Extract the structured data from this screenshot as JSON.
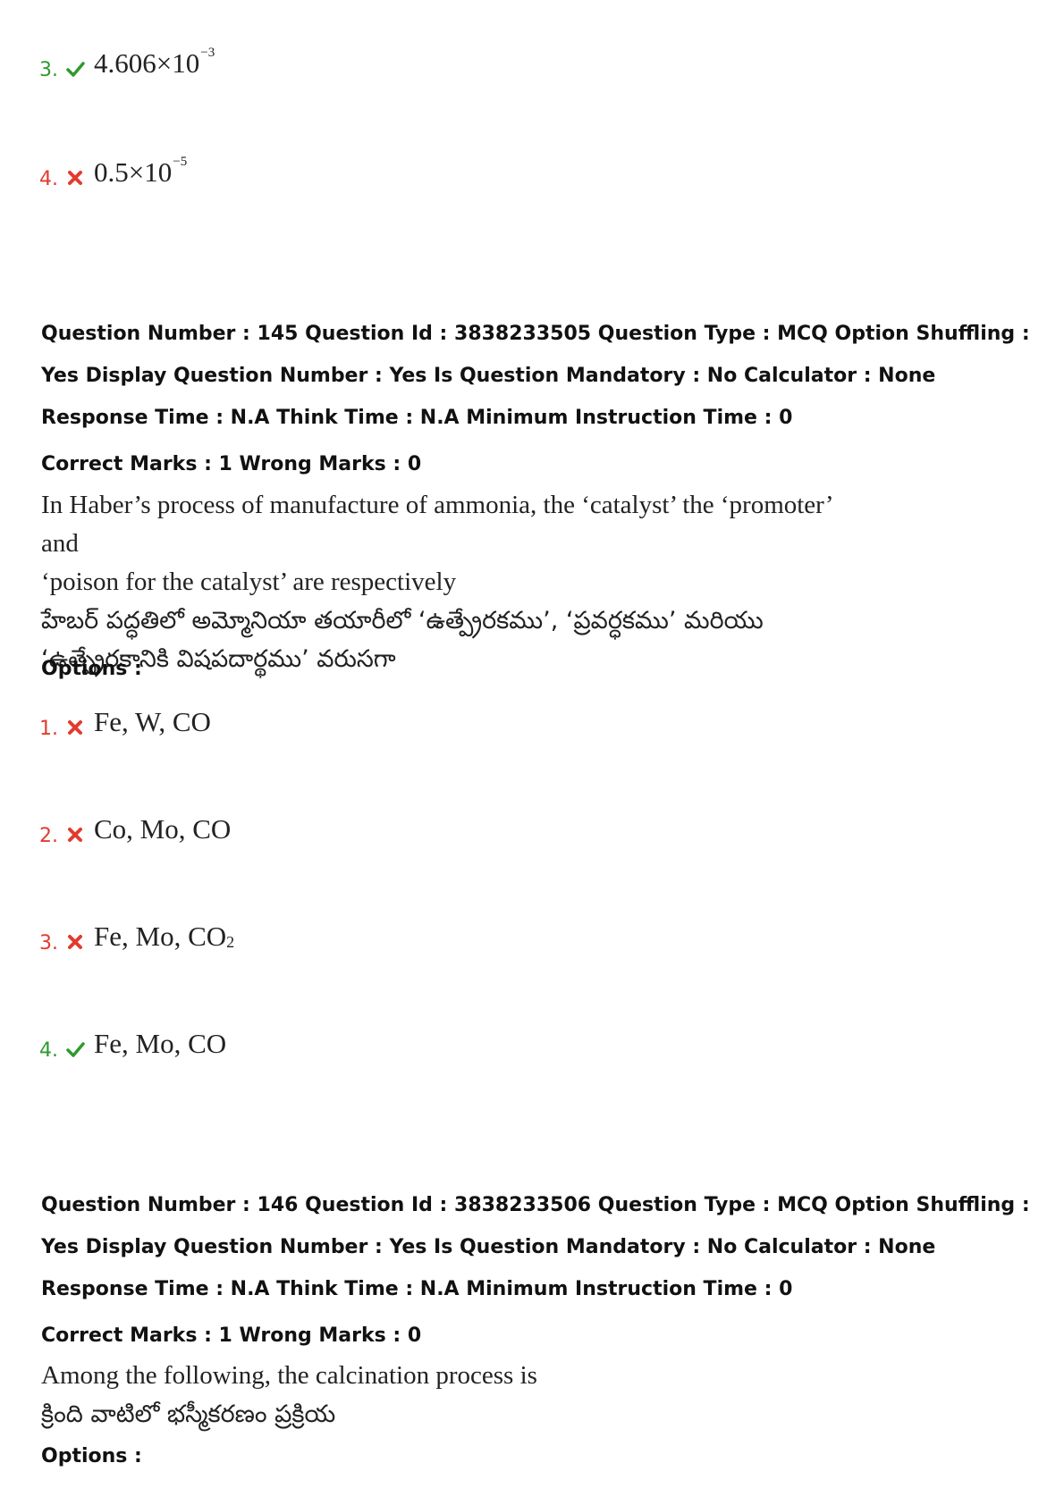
{
  "prev_options": [
    {
      "num": "3.",
      "status": "correct",
      "icon": "check-icon",
      "mantissa": "4.606×10",
      "exponent": "−3"
    },
    {
      "num": "4.",
      "status": "wrong",
      "icon": "cross-icon",
      "mantissa": "0.5×10",
      "exponent": "−5"
    }
  ],
  "q145": {
    "meta": "Question Number : 145 Question Id : 3838233505 Question Type : MCQ Option Shuffling : Yes Display Question Number : Yes Is Question Mandatory : No Calculator : None Response Time : N.A Think Time : N.A Minimum Instruction Time : 0",
    "marks": "Correct Marks : 1 Wrong Marks : 0",
    "text_en_1": "In Haber’s process of manufacture of ammonia, the ‘catalyst’ the ‘promoter’ and",
    "text_en_2": "‘poison for the catalyst’ are respectively",
    "text_te_1": "హేబర్ పద్ధతిలో అమ్మోనియా తయారీలో ‘ఉత్ప్రేరకము’, ‘ప్రవర్ధకము’ మరియు",
    "text_te_2": "‘ఉత్ప్రేరకానికి విషపదార్థము’ వరుసగా",
    "options_label": "Options :",
    "options": [
      {
        "num": "1.",
        "status": "wrong",
        "icon": "cross-icon",
        "text": "Fe, W, CO"
      },
      {
        "num": "2.",
        "status": "wrong",
        "icon": "cross-icon",
        "text": "Co, Mo, CO"
      },
      {
        "num": "3.",
        "status": "wrong",
        "icon": "cross-icon",
        "text": "Fe, Mo, CO",
        "sub": "2"
      },
      {
        "num": "4.",
        "status": "correct",
        "icon": "check-icon",
        "text": "Fe, Mo, CO"
      }
    ]
  },
  "q146": {
    "meta": "Question Number : 146 Question Id : 3838233506 Question Type : MCQ Option Shuffling : Yes Display Question Number : Yes Is Question Mandatory : No Calculator : None Response Time : N.A Think Time : N.A Minimum Instruction Time : 0",
    "marks": "Correct Marks : 1 Wrong Marks : 0",
    "text_en_1": "Among the following, the calcination process is",
    "text_te_1": "క్రింది వాటిలో భస్మీకరణం ప్రక్రియ",
    "options_label": "Options :"
  },
  "colors": {
    "correct": "#2e9a2e",
    "wrong": "#e23b2e"
  }
}
